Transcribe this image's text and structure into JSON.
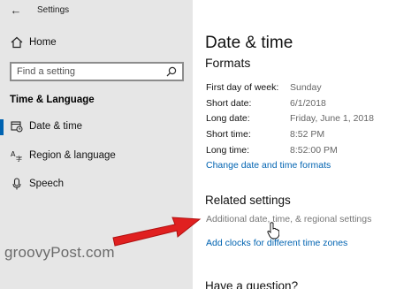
{
  "window": {
    "title": "Settings",
    "back_glyph": "←"
  },
  "sidebar": {
    "home_label": "Home",
    "search_placeholder": "Find a setting",
    "section_header": "Time & Language",
    "items": [
      {
        "label": "Date & time",
        "icon": "calendar-clock-icon",
        "active": true
      },
      {
        "label": "Region & language",
        "icon": "region-language-icon",
        "active": false
      },
      {
        "label": "Speech",
        "icon": "microphone-icon",
        "active": false
      }
    ],
    "accent_color": "#0063b1"
  },
  "main": {
    "title": "Date & time",
    "formats_heading": "Formats",
    "formats": [
      {
        "label": "First day of week:",
        "value": "Sunday"
      },
      {
        "label": "Short date:",
        "value": "6/1/2018"
      },
      {
        "label": "Long date:",
        "value": "Friday, June 1, 2018"
      },
      {
        "label": "Short time:",
        "value": "8:52 PM"
      },
      {
        "label": "Long time:",
        "value": "8:52:00 PM"
      }
    ],
    "change_formats_link": "Change date and time formats",
    "related_heading": "Related settings",
    "related_links": [
      "Additional date, time, & regional settings",
      "Add clocks for different time zones"
    ],
    "question_heading": "Have a question?"
  },
  "watermark": "groovyPost.com",
  "annotation": {
    "arrow_color": "#e02020"
  }
}
